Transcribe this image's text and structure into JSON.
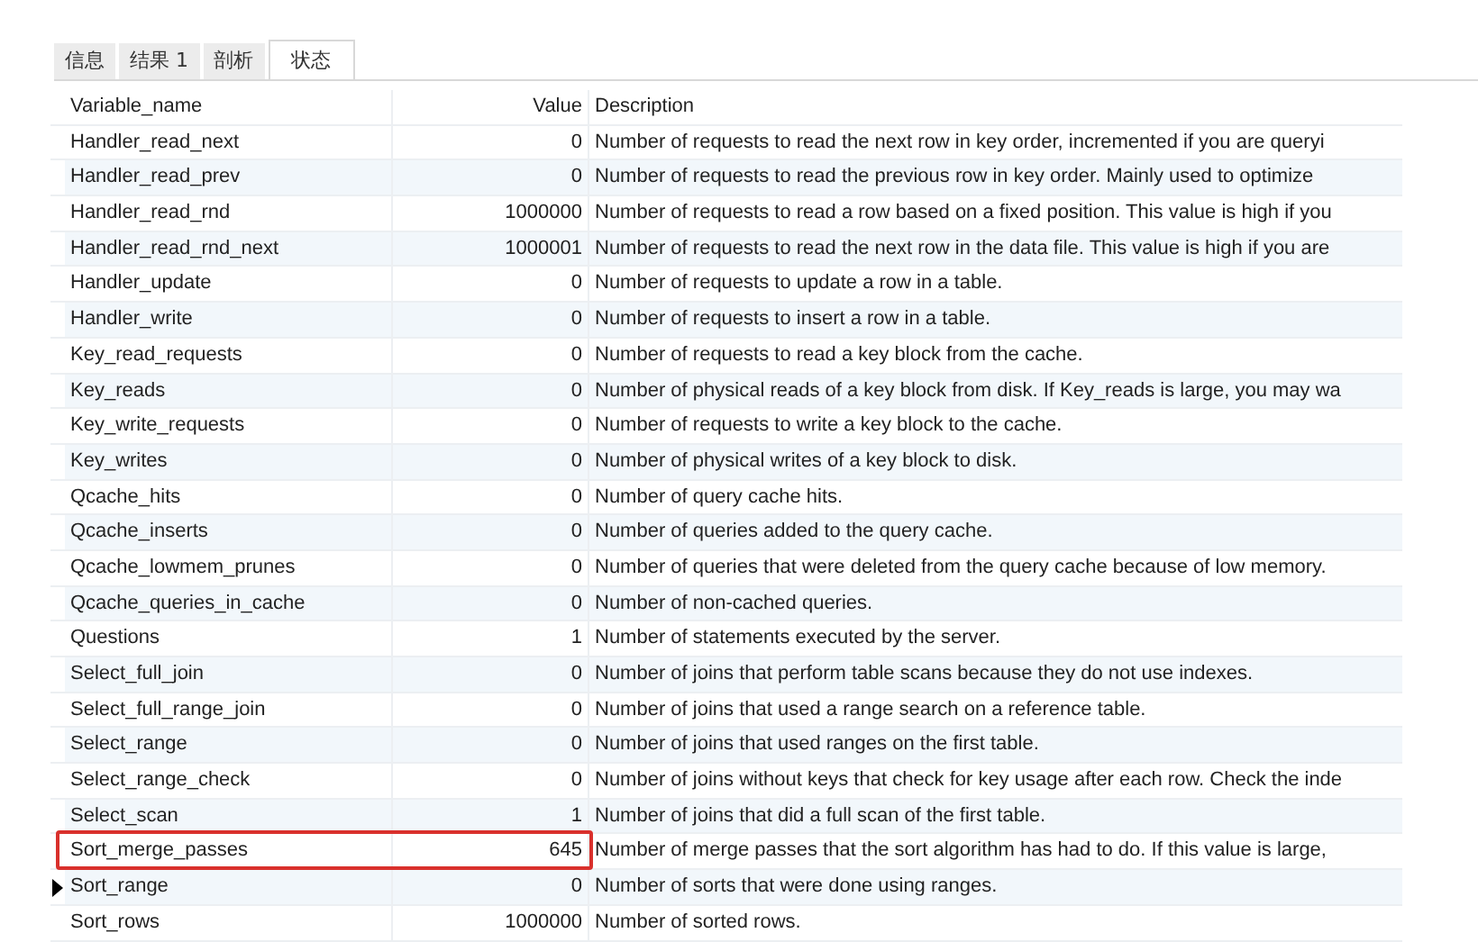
{
  "tabs": [
    {
      "label": "信息",
      "selected": false
    },
    {
      "label": "结果 1",
      "selected": false
    },
    {
      "label": "剖析",
      "selected": false
    },
    {
      "label": "状态",
      "selected": true
    }
  ],
  "table": {
    "columns": [
      "Variable_name",
      "Value",
      "Description"
    ],
    "rows": [
      {
        "name": "Handler_read_next",
        "value": "0",
        "description": "Number of requests to read the next row in key order, incremented if you are queryi",
        "current": false,
        "highlighted": false
      },
      {
        "name": "Handler_read_prev",
        "value": "0",
        "description": "Number of requests to read the previous row in key order. Mainly used to optimize",
        "current": false,
        "highlighted": false
      },
      {
        "name": "Handler_read_rnd",
        "value": "1000000",
        "description": "Number of requests to read a row based on a fixed position. This value is high if you",
        "current": false,
        "highlighted": false
      },
      {
        "name": "Handler_read_rnd_next",
        "value": "1000001",
        "description": "Number of requests to read the next row in the data file. This value is high if you are",
        "current": false,
        "highlighted": false
      },
      {
        "name": "Handler_update",
        "value": "0",
        "description": "Number of requests to update a row in a table.",
        "current": false,
        "highlighted": false
      },
      {
        "name": "Handler_write",
        "value": "0",
        "description": "Number of requests to insert a row in a table.",
        "current": false,
        "highlighted": false
      },
      {
        "name": "Key_read_requests",
        "value": "0",
        "description": "Number of requests to read a key block from the cache.",
        "current": false,
        "highlighted": false
      },
      {
        "name": "Key_reads",
        "value": "0",
        "description": "Number of physical reads of a key block from disk. If Key_reads is large, you may wa",
        "current": false,
        "highlighted": false
      },
      {
        "name": "Key_write_requests",
        "value": "0",
        "description": "Number of requests to write a key block to the cache.",
        "current": false,
        "highlighted": false
      },
      {
        "name": "Key_writes",
        "value": "0",
        "description": "Number of physical writes of a key block to disk.",
        "current": false,
        "highlighted": false
      },
      {
        "name": "Qcache_hits",
        "value": "0",
        "description": "Number of query cache hits.",
        "current": false,
        "highlighted": false
      },
      {
        "name": "Qcache_inserts",
        "value": "0",
        "description": "Number of queries added to the query cache.",
        "current": false,
        "highlighted": false
      },
      {
        "name": "Qcache_lowmem_prunes",
        "value": "0",
        "description": "Number of queries that were deleted from the query cache because of low memory.",
        "current": false,
        "highlighted": false
      },
      {
        "name": "Qcache_queries_in_cache",
        "value": "0",
        "description": "Number of non-cached queries.",
        "current": false,
        "highlighted": false
      },
      {
        "name": "Questions",
        "value": "1",
        "description": "Number of statements executed by the server.",
        "current": false,
        "highlighted": false
      },
      {
        "name": "Select_full_join",
        "value": "0",
        "description": "Number of joins that perform table scans because they do not use indexes.",
        "current": false,
        "highlighted": false
      },
      {
        "name": "Select_full_range_join",
        "value": "0",
        "description": "Number of joins that used a range search on a reference table.",
        "current": false,
        "highlighted": false
      },
      {
        "name": "Select_range",
        "value": "0",
        "description": "Number of joins that used ranges on the first table.",
        "current": false,
        "highlighted": false
      },
      {
        "name": "Select_range_check",
        "value": "0",
        "description": "Number of joins without keys that check for key usage after each row. Check the inde",
        "current": false,
        "highlighted": false
      },
      {
        "name": "Select_scan",
        "value": "1",
        "description": "Number of joins that did a full scan of the first table.",
        "current": false,
        "highlighted": false
      },
      {
        "name": "Sort_merge_passes",
        "value": "645",
        "description": "Number of merge passes that the sort algorithm has had to do. If this value is large,",
        "current": false,
        "highlighted": true
      },
      {
        "name": "Sort_range",
        "value": "0",
        "description": "Number of sorts that were done using ranges.",
        "current": true,
        "highlighted": false
      },
      {
        "name": "Sort_rows",
        "value": "1000000",
        "description": "Number of sorted rows.",
        "current": false,
        "highlighted": false
      }
    ]
  }
}
